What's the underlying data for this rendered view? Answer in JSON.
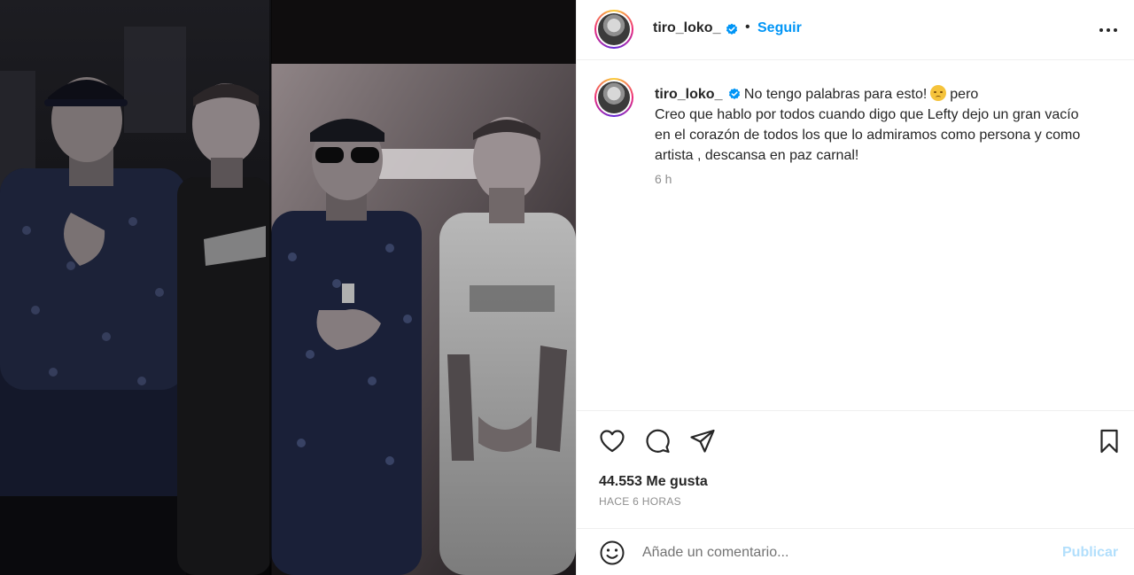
{
  "post": {
    "image_alt": "Dos fotos de cuatro hombres con tatuajes posando en un estudio",
    "author": {
      "username": "tiro_loko_",
      "verified": true
    },
    "follow_label": "Seguir",
    "separator": "•",
    "caption": {
      "line1": "No tengo palabras para esto!",
      "line1_after_emoji": "pero",
      "body": "Creo que hablo por todos cuando digo que Lefty dejo un gran vacío en el corazón de todos los que lo admiramos como persona y como artista , descansa en paz carnal!",
      "emoji": "disappointed-face-icon",
      "time": "6 h"
    },
    "likes_text": "44.553 Me gusta",
    "posted_ago": "HACE 6 HORAS"
  },
  "comment": {
    "placeholder": "Añade un comentario...",
    "publish_label": "Publicar"
  },
  "colors": {
    "accent": "#0095f6",
    "publish_disabled": "#b2dffc",
    "text": "#262626",
    "muted": "#8e8e8e",
    "divider": "#efefef"
  },
  "icons": [
    "more-options-icon",
    "heart-icon",
    "comment-icon",
    "share-icon",
    "bookmark-icon",
    "emoji-smile-icon",
    "verified-badge-icon"
  ]
}
